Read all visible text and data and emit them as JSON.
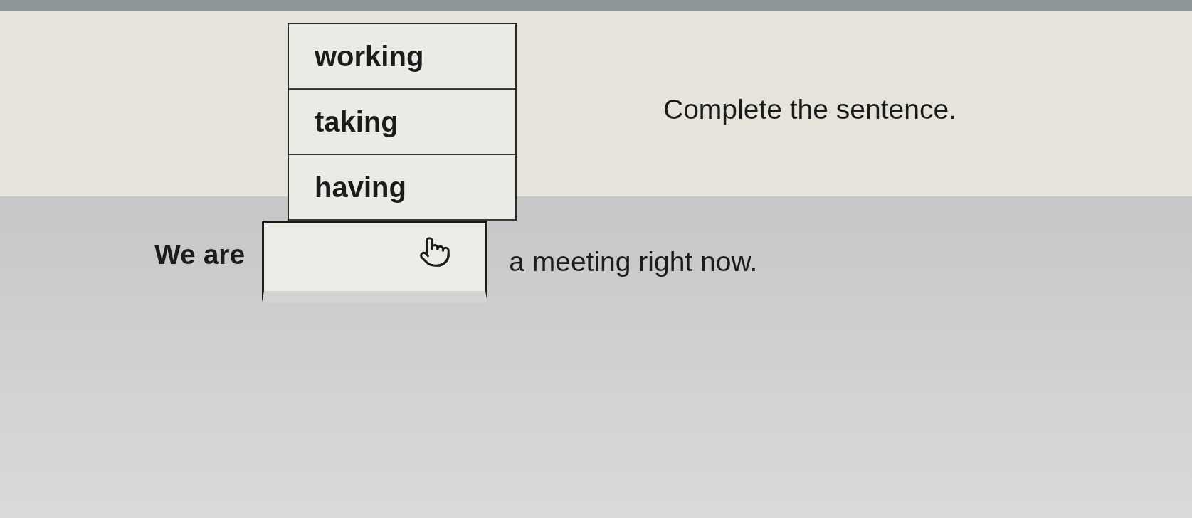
{
  "question": {
    "instruction": "Complete the sentence.",
    "before_blank": "We are",
    "after_blank": "a meeting right now."
  },
  "dropdown": {
    "expanded": true,
    "options": [
      {
        "label": "working",
        "selected": false
      },
      {
        "label": "taking",
        "selected": false
      },
      {
        "label": "having",
        "selected": false
      }
    ]
  }
}
